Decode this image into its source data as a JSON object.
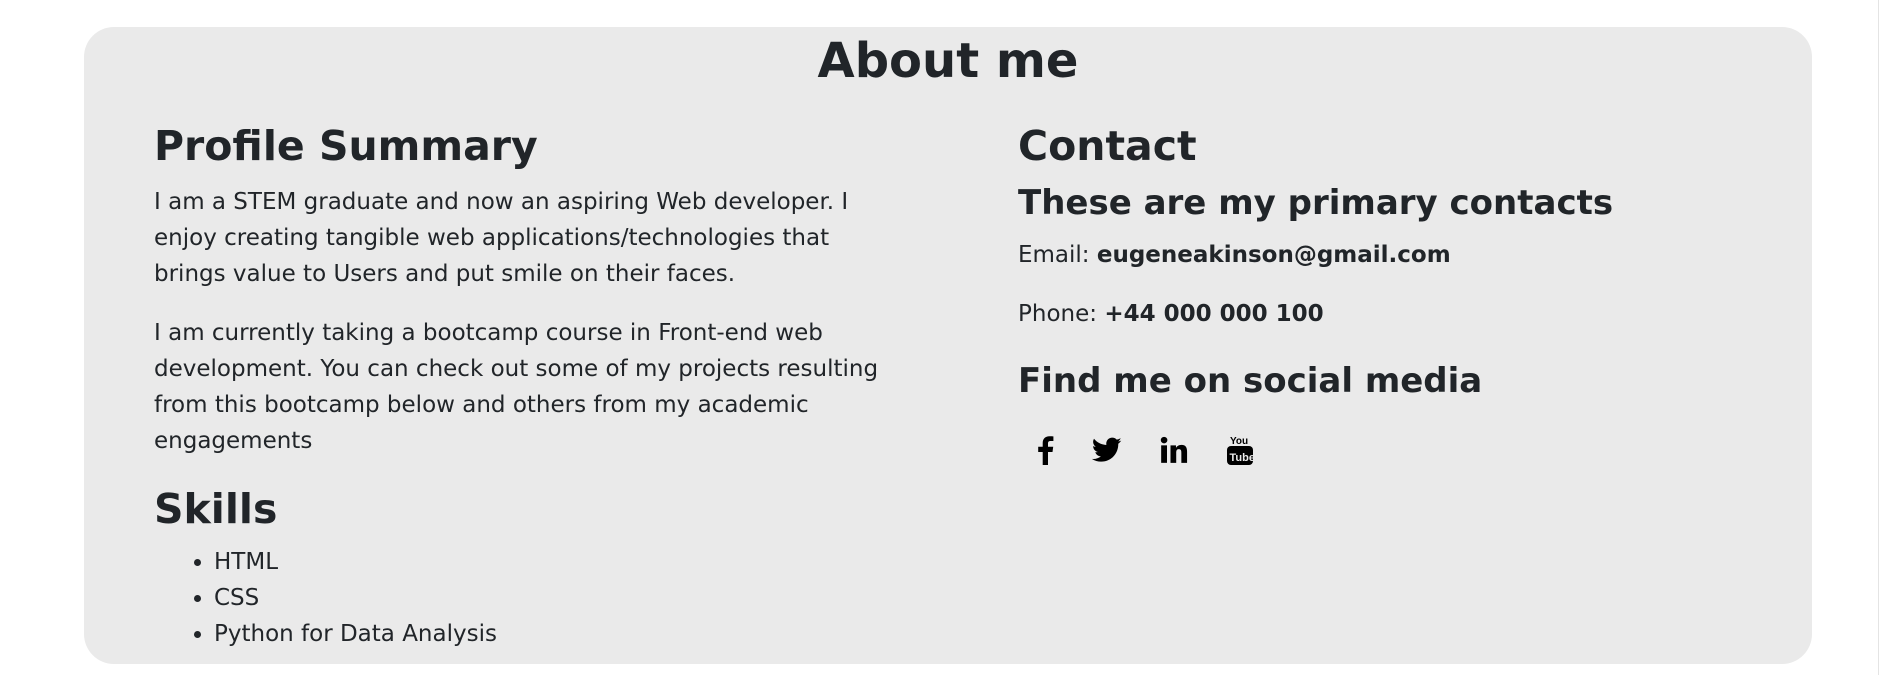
{
  "about": {
    "title": "About me"
  },
  "profile": {
    "heading": "Profile Summary",
    "paragraph1": "I am a STEM graduate and now an aspiring Web developer. I enjoy creating tangible web applications/technologies that brings value to Users and put smile on their faces.",
    "paragraph2": "I am currently taking a bootcamp course in Front-end web development. You can check out some of my projects resulting from this bootcamp below and others from my academic engagements"
  },
  "skills": {
    "heading": "Skills",
    "items": [
      "HTML",
      "CSS",
      "Python for Data Analysis"
    ]
  },
  "contact": {
    "heading": "Contact",
    "subheading": "These are my primary contacts",
    "email_label": "Email: ",
    "email_value": "eugeneakinson@gmail.com",
    "phone_label": "Phone: ",
    "phone_value": "+44 000 000 100"
  },
  "social": {
    "heading": "Find me on social media",
    "icons": [
      "facebook-icon",
      "twitter-icon",
      "linkedin-icon",
      "youtube-icon"
    ]
  },
  "colors": {
    "card_background": "#eaeaea",
    "text": "#212529",
    "icon": "#000000"
  }
}
